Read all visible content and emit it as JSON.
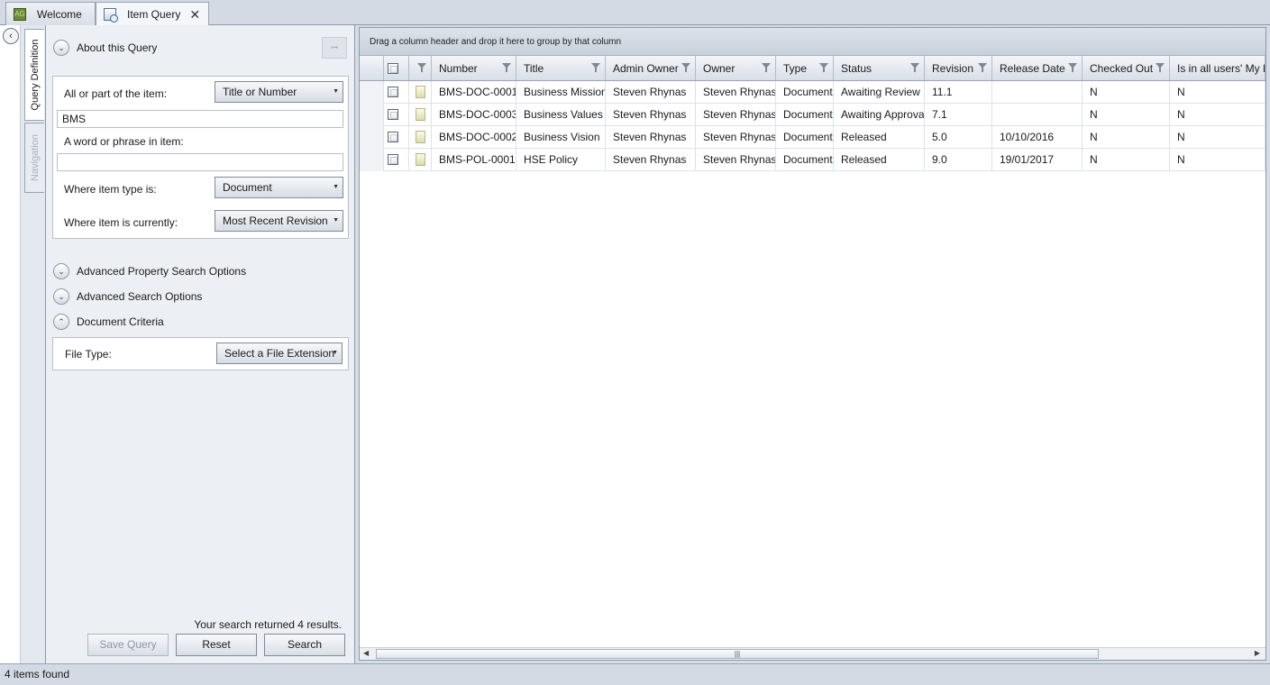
{
  "tabs": [
    {
      "label": "Welcome",
      "icon": "app-logo-icon"
    },
    {
      "label": "Item Query",
      "icon": "query-icon",
      "closable": true
    }
  ],
  "side_tabs": [
    "Query Definition",
    "Navigation"
  ],
  "query": {
    "about_title": "About this Query",
    "item_label": "All or part of the item:",
    "item_mode": "Title or Number",
    "item_value": "BMS",
    "phrase_label": "A word or phrase in item:",
    "phrase_value": "",
    "type_label": "Where item type is:",
    "type_value": "Document",
    "current_label": "Where item is currently:",
    "current_value": "Most Recent Revision",
    "adv_property_title": "Advanced Property Search Options",
    "adv_search_title": "Advanced Search Options",
    "doc_criteria_title": "Document Criteria",
    "file_type_label": "File Type:",
    "file_type_value": "Select a File Extension",
    "result_message": "Your search returned 4 results.",
    "save_label": "Save Query",
    "reset_label": "Reset",
    "search_label": "Search"
  },
  "grid": {
    "group_hint": "Drag a column header and drop it here to group by that column",
    "columns": [
      "Number",
      "Title",
      "Admin Owner",
      "Owner",
      "Type",
      "Status",
      "Revision",
      "Release Date",
      "Checked Out",
      "Is in all users' My Do"
    ],
    "rows": [
      {
        "number": "BMS-DOC-0001",
        "title": "Business Mission",
        "admin_owner": "Steven Rhynas",
        "owner": "Steven Rhynas",
        "type": "Document",
        "status": "Awaiting Review",
        "revision": "11.1",
        "release_date": "",
        "checked_out": "N",
        "in_my_docs": "N"
      },
      {
        "number": "BMS-DOC-0003",
        "title": "Business Values",
        "admin_owner": "Steven Rhynas",
        "owner": "Steven Rhynas",
        "type": "Document",
        "status": "Awaiting Approval",
        "revision": "7.1",
        "release_date": "",
        "checked_out": "N",
        "in_my_docs": "N"
      },
      {
        "number": "BMS-DOC-0002",
        "title": "Business Vision",
        "admin_owner": "Steven Rhynas",
        "owner": "Steven Rhynas",
        "type": "Document",
        "status": "Released",
        "revision": "5.0",
        "release_date": "10/10/2016",
        "checked_out": "N",
        "in_my_docs": "N"
      },
      {
        "number": "BMS-POL-0001",
        "title": "HSE Policy",
        "admin_owner": "Steven Rhynas",
        "owner": "Steven Rhynas",
        "type": "Document",
        "status": "Released",
        "revision": "9.0",
        "release_date": "19/01/2017",
        "checked_out": "N",
        "in_my_docs": "N"
      }
    ]
  },
  "status": {
    "text": "4 items found"
  },
  "colors": {
    "accent": "#8c99a8",
    "panel": "#ecf0f4",
    "chrome": "#d3dae3"
  }
}
